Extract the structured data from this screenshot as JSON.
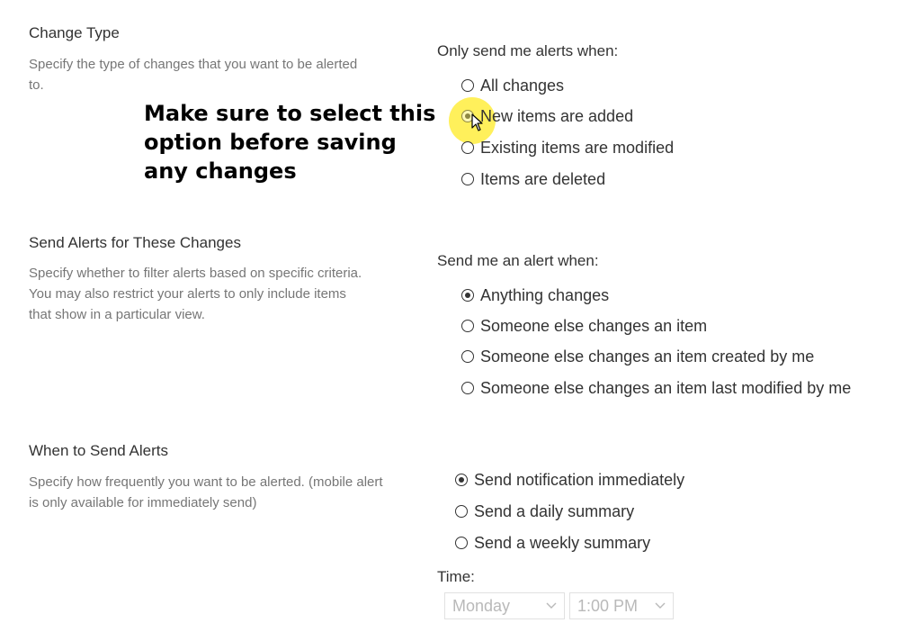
{
  "change_type": {
    "title": "Change Type",
    "description": "Specify the type of changes that you want to be alerted to.",
    "prompt": "Only send me alerts when:",
    "options": [
      {
        "label": "All changes",
        "checked": false
      },
      {
        "label": "New items are added",
        "checked": true
      },
      {
        "label": "Existing items are modified",
        "checked": false
      },
      {
        "label": "Items are deleted",
        "checked": false
      }
    ]
  },
  "annotation": {
    "text": "Make sure to select this option before saving any changes",
    "highlight_color": "#ffec32"
  },
  "send_alerts": {
    "title": "Send Alerts for These Changes",
    "description": "Specify whether to filter alerts based on specific criteria. You may also restrict your alerts to only include items that show in a particular view.",
    "prompt": "Send me an alert when:",
    "options": [
      {
        "label": "Anything changes",
        "checked": true
      },
      {
        "label": "Someone else changes an item",
        "checked": false
      },
      {
        "label": "Someone else changes an item created by me",
        "checked": false
      },
      {
        "label": "Someone else changes an item last modified by me",
        "checked": false
      }
    ]
  },
  "when_to_send": {
    "title": "When to Send Alerts",
    "description": "Specify how frequently you want to be alerted. (mobile alert is only available for immediately send)",
    "options": [
      {
        "label": "Send notification immediately",
        "checked": true
      },
      {
        "label": "Send a daily summary",
        "checked": false
      },
      {
        "label": "Send a weekly summary",
        "checked": false
      }
    ],
    "time_label": "Time:",
    "day_select": {
      "value": "Monday",
      "disabled": true
    },
    "time_select": {
      "value": "1:00 PM",
      "disabled": true
    }
  },
  "colors": {
    "text": "#333333",
    "muted": "#767676",
    "disabled": "#b9b9b9"
  }
}
